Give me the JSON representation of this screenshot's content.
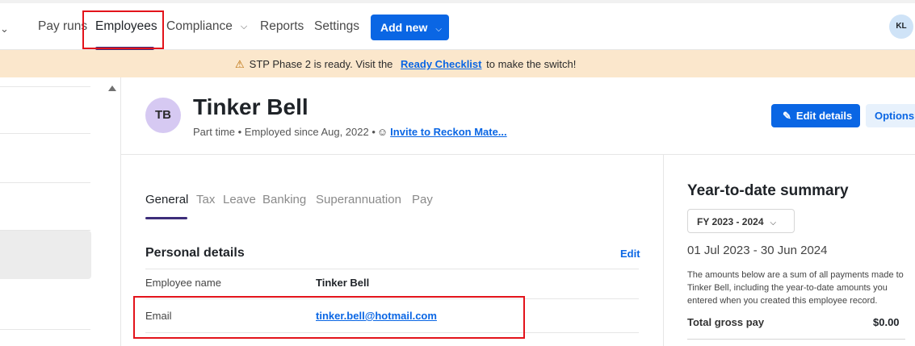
{
  "nav": {
    "items": [
      "Pay runs",
      "Employees",
      "Compliance",
      "Reports",
      "Settings"
    ],
    "add_new_label": "Add new",
    "user_initials": "KL"
  },
  "banner": {
    "text_before": "STP Phase 2 is ready. Visit the",
    "link": "Ready Checklist",
    "text_after": "to make the switch!"
  },
  "employee": {
    "initials": "TB",
    "name": "Tinker Bell",
    "subtitle": "Part time • Employed since Aug, 2022 •",
    "invite_link": "Invite to Reckon Mate...",
    "edit_label": "Edit details",
    "options_label": "Options"
  },
  "tabs": [
    "General",
    "Tax",
    "Leave",
    "Banking",
    "Superannuation",
    "Pay"
  ],
  "personal": {
    "title": "Personal details",
    "edit_label": "Edit",
    "fields": [
      {
        "label": "Employee name",
        "value": "Tinker Bell"
      },
      {
        "label": "Email",
        "value": "tinker.bell@hotmail.com"
      }
    ]
  },
  "ytd": {
    "title": "Year-to-date summary",
    "fy_selected": "FY 2023 - 2024",
    "range": "01 Jul 2023 - 30 Jun 2024",
    "note": "The amounts below are a sum of all payments made to Tinker Bell, including the year-to-date amounts you entered when you created this employee record.",
    "gross_label": "Total gross pay",
    "gross_value": "$0.00"
  },
  "colors": {
    "accent": "#0a66e4",
    "nav_underline": "#3d2d7a",
    "banner_bg": "#fbe7cc",
    "highlight": "#e3131b"
  }
}
